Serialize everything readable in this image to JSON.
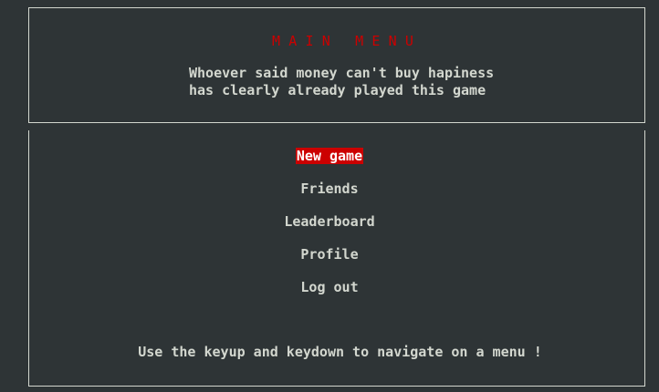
{
  "header": {
    "title": "MAIN MENU",
    "tagline_line_1": "Whoever said money can't buy hapiness",
    "tagline_line_2": "has clearly already played this game"
  },
  "menu": {
    "items": [
      {
        "label": "New game",
        "selected": true
      },
      {
        "label": "Friends",
        "selected": false
      },
      {
        "label": "Leaderboard",
        "selected": false
      },
      {
        "label": "Profile",
        "selected": false
      },
      {
        "label": "Log out",
        "selected": false
      }
    ]
  },
  "footer": {
    "hint": "Use the keyup and keydown to navigate on a menu !"
  },
  "colors": {
    "background": "#2e3436",
    "foreground": "#d3d7cf",
    "accent_red": "#cc0000"
  }
}
